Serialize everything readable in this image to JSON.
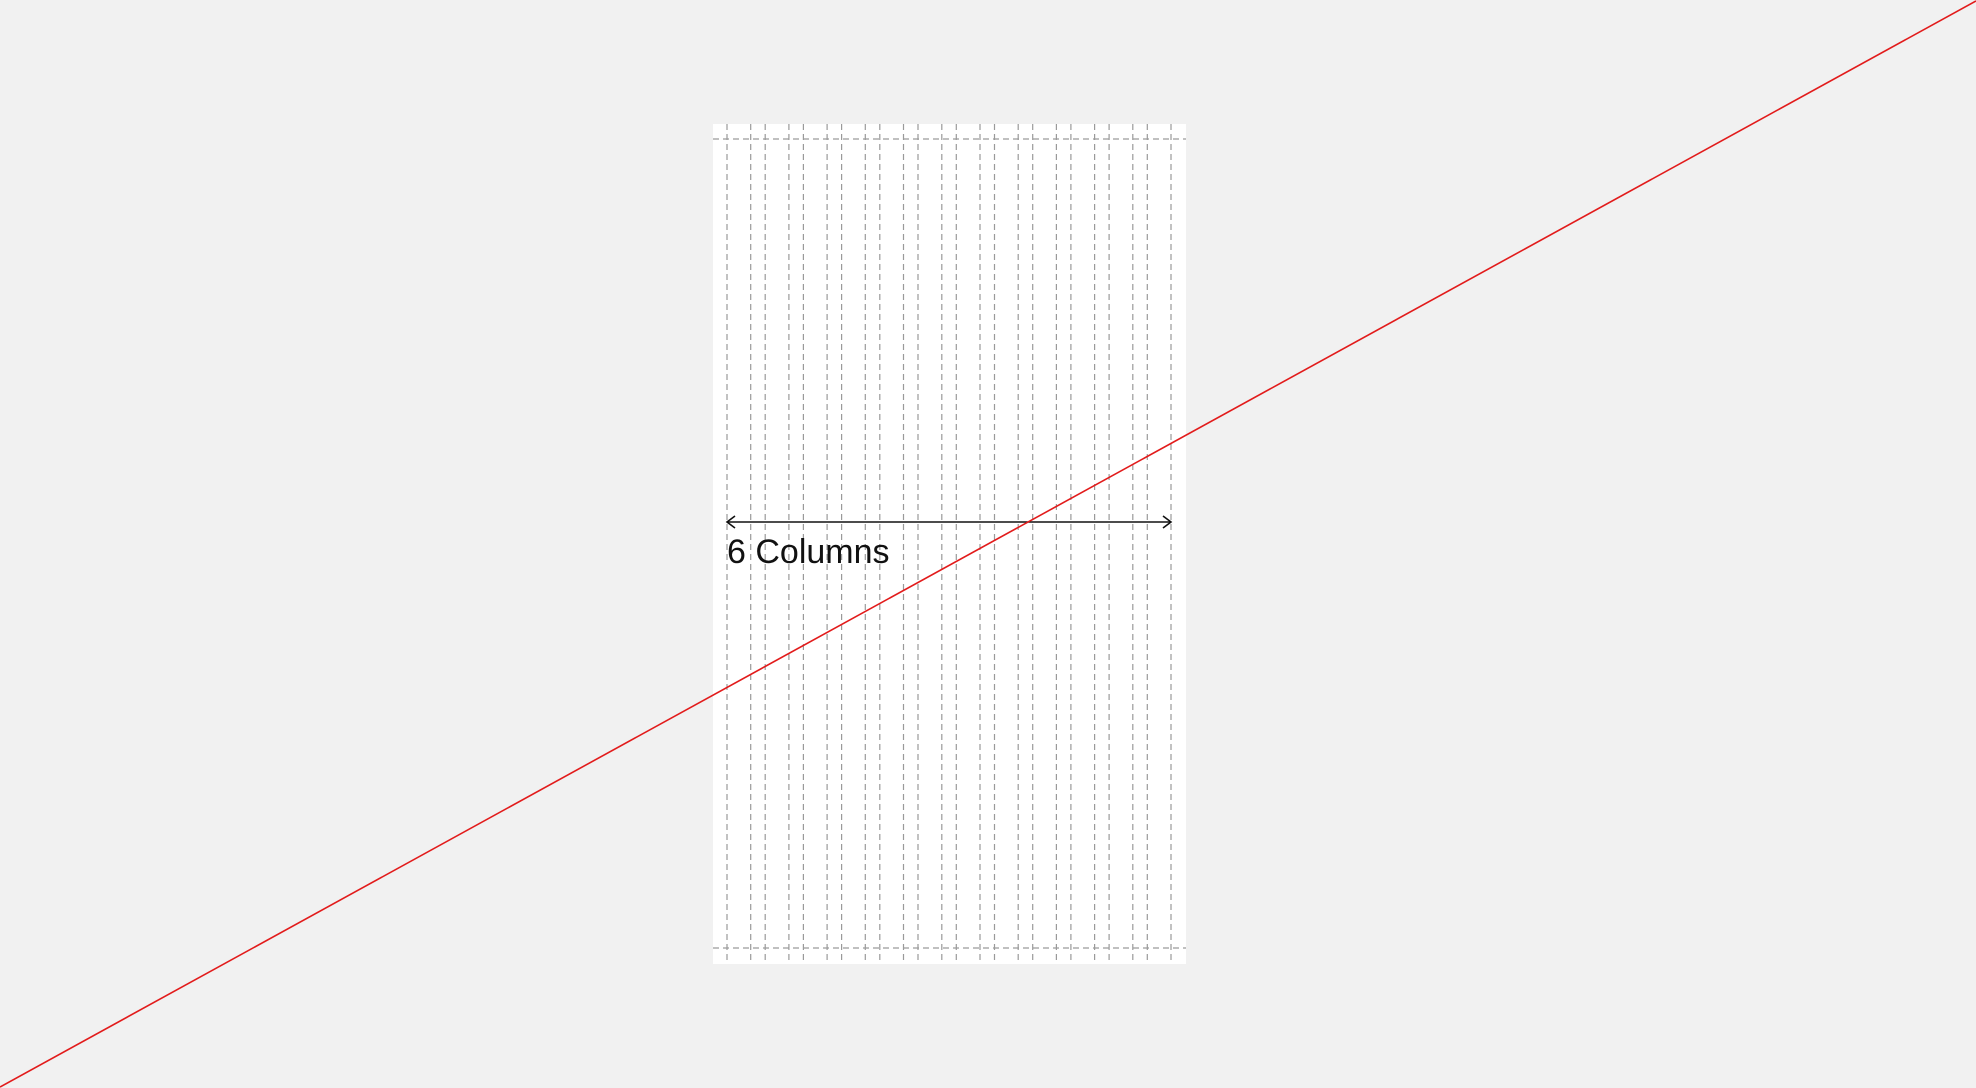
{
  "annotation": {
    "span_label": "6 Columns"
  },
  "colors": {
    "background": "#f1f1f1",
    "page": "#ffffff",
    "guide": "#9a9a9a",
    "arrow": "#111111",
    "strike": "#e21b1b"
  }
}
